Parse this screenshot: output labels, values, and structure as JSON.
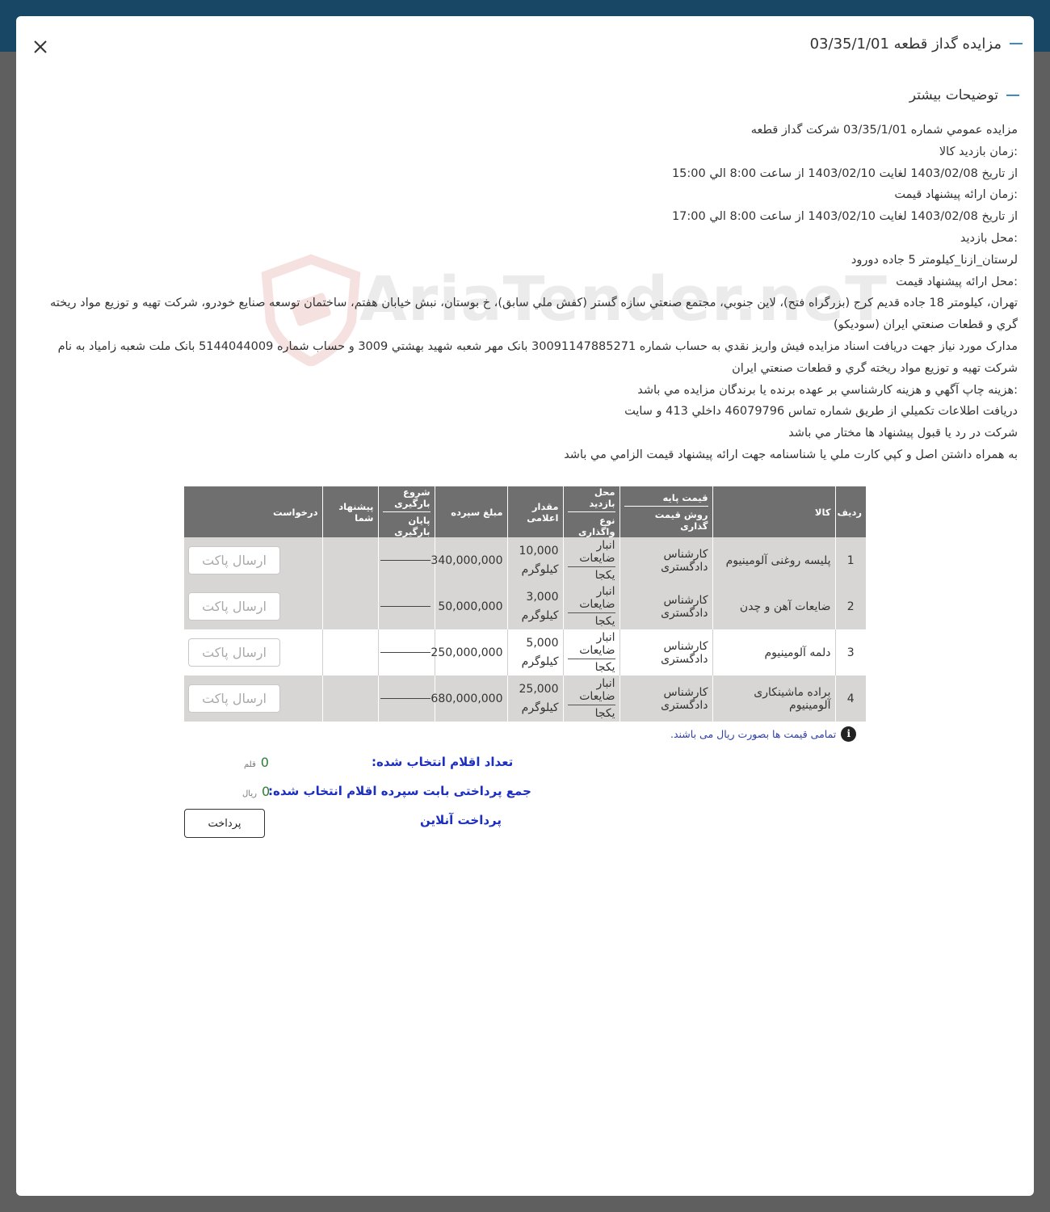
{
  "modal": {
    "title": "مزایده گداز قطعه 03/35/1/01",
    "section_title": "توضیحات بیشتر"
  },
  "description": [
    "مزايده عمومي شماره 03/35/1/01 شرکت گداز قطعه",
    ":زمان بازديد کالا",
    "از تاريخ 1403/02/08 لغايت 1403/02/10 از ساعت 8:00 الي 15:00",
    ":زمان ارائه پيشنهاد قيمت",
    "از تاريخ 1403/02/08 لغايت 1403/02/10 از ساعت 8:00 الي 17:00",
    ":محل بازديد",
    "لرستان_ازنا_کيلومتر 5 جاده دورود",
    ":محل ارائه پيشنهاد قيمت",
    "تهران، کيلومتر 18 جاده قديم کرج (بزرگراه فتح)، لاين جنوبي، مجتمع صنعتي سازه گستر (کفش ملي سابق)، خ بوستان، نبش خيابان هفتم، ساختمان توسعه صنايع خودرو، شرکت تهيه و توزيع مواد ريخته گري و قطعات صنعتي ايران (سوديکو)",
    "مدارک مورد نياز جهت دريافت اسناد مزايده فيش واريز نقدي به حساب شماره 30091147885271 بانک مهر شعبه شهيد بهشتي 3009 و حساب شماره 5144044009 بانک ملت شعبه زامياد به نام شرکت تهيه و توزيع مواد ريخته گري و قطعات صنعتي ايران",
    ":هزينه چاپ آگهي و هزينه کارشناسي بر عهده برنده يا برندگان مزايده مي باشد",
    "دريافت اطلاعات تکميلي از طريق شماره تماس 46079796 داخلي 413 و سايت",
    "شرکت در رد يا قبول پيشنهاد ها مختار مي باشد",
    "به همراه داشتن اصل و کپي کارت ملي يا شناسنامه جهت ارائه پيشنهاد قيمت الزامي مي باشد"
  ],
  "watermark": "AriaTender.neT",
  "table": {
    "headers": {
      "row": "رديف",
      "item": "کالا",
      "base_price": "قيمت پايه",
      "pricing_method": "روش قيمت گذاری",
      "visit_place": "محل بازديد",
      "transfer_type": "نوع واگذاری",
      "quantity": "مقدار اعلامی",
      "deposit": "مبلغ سپرده",
      "load_start": "شروع بارگیری",
      "load_end": "پایان بارگیری",
      "your_offer": "پیشنهاد شما",
      "request": "درخواست"
    },
    "rows": [
      {
        "row": "1",
        "item": "پليسه روغنی آلومينيوم",
        "pricing": "کارشناس دادگستری",
        "visit_place": "انبار ضایعات",
        "transfer": "يکجا",
        "qty": "10,000",
        "unit": "کيلوگرم",
        "deposit": "340,000,000",
        "action": "ارسال پاکت"
      },
      {
        "row": "2",
        "item": "ضايعات آهن و چدن",
        "pricing": "کارشناس دادگستری",
        "visit_place": "انبار ضایعات",
        "transfer": "يکجا",
        "qty": "3,000",
        "unit": "کيلوگرم",
        "deposit": "50,000,000",
        "action": "ارسال پاکت"
      },
      {
        "row": "3",
        "item": "دلمه آلومينيوم",
        "pricing": "کارشناس دادگستری",
        "visit_place": "انبار ضایعات",
        "transfer": "يکجا",
        "qty": "5,000",
        "unit": "کيلوگرم",
        "deposit": "250,000,000",
        "action": "ارسال پاکت"
      },
      {
        "row": "4",
        "item": "براده ماشينکاری آلومينيوم",
        "pricing": "کارشناس دادگستری",
        "visit_place": "انبار ضایعات",
        "transfer": "يکجا",
        "qty": "25,000",
        "unit": "کيلوگرم",
        "deposit": "680,000,000",
        "action": "ارسال پاکت"
      }
    ]
  },
  "note": "تمامی قیمت ها بصورت ریال می باشند.",
  "summary": {
    "count_label": "تعداد اقلام انتخاب شده:",
    "count_value": "0",
    "count_unit": "قلم",
    "sum_label": "جمع پرداختی بابت سپرده اقلام انتخاب شده:",
    "sum_value": "0",
    "sum_unit": "ریال",
    "online_pay": "پرداخت آنلاین",
    "pay_button": "پرداخت"
  },
  "colors": {
    "header_bar": "#174765",
    "table_header": "#6f6f6f",
    "row_shade": "#d8d5d5",
    "accent_blue": "#1c2fc0",
    "title_dash": "#3b8cc4"
  }
}
